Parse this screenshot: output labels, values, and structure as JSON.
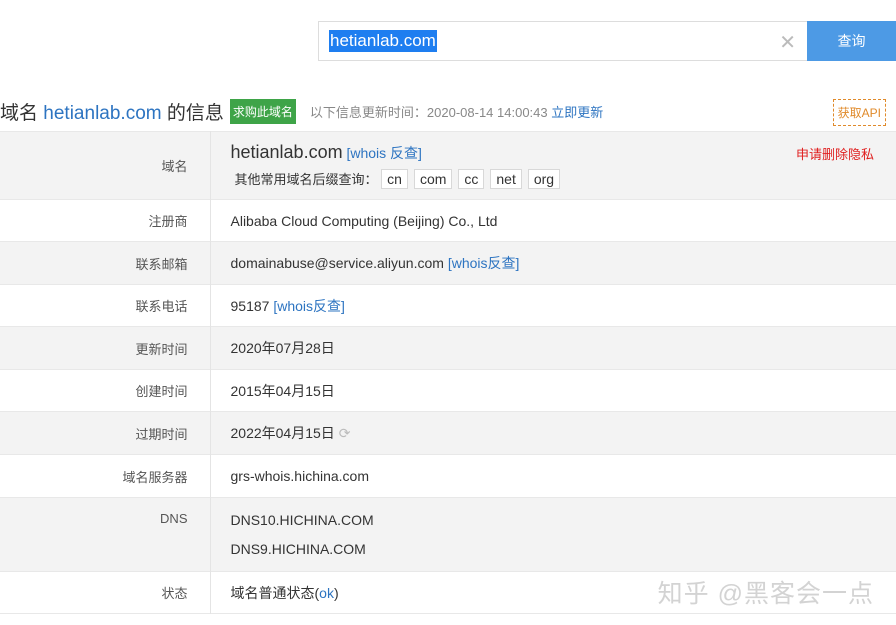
{
  "search": {
    "value": "hetianlab.com",
    "clear_icon": "close-icon",
    "button": "查询"
  },
  "header": {
    "prefix": "域名",
    "domain": "hetianlab.com",
    "suffix": "的信息",
    "buy": "求购此域名",
    "update_label": "以下信息更新时间：2020-08-14 14:00:43",
    "update_now": "立即更新",
    "api": "获取API"
  },
  "rows": {
    "domain": {
      "label": "域名",
      "value": "hetianlab.com",
      "whois": "[whois 反查]",
      "other_label": "其他常用域名后缀查询：",
      "tlds": [
        "cn",
        "com",
        "cc",
        "net",
        "org"
      ],
      "delete_privacy": "申请删除隐私"
    },
    "registrar": {
      "label": "注册商",
      "value": "Alibaba Cloud Computing (Beijing) Co., Ltd"
    },
    "email": {
      "label": "联系邮箱",
      "value": "domainabuse@service.aliyun.com",
      "whois": "[whois反查]"
    },
    "phone": {
      "label": "联系电话",
      "value": "95187",
      "whois": "[whois反查]"
    },
    "updated": {
      "label": "更新时间",
      "value": "2020年07月28日"
    },
    "created": {
      "label": "创建时间",
      "value": "2015年04月15日"
    },
    "expires": {
      "label": "过期时间",
      "value": "2022年04月15日",
      "icon": "refresh-icon"
    },
    "server": {
      "label": "域名服务器",
      "value": "grs-whois.hichina.com"
    },
    "dns": {
      "label": "DNS",
      "values": [
        "DNS10.HICHINA.COM",
        "DNS9.HICHINA.COM"
      ]
    },
    "status": {
      "label": "状态",
      "value": "域名普通状态(",
      "ok": "ok",
      "close": ")"
    }
  },
  "watermark": "知乎 @黑客会一点"
}
